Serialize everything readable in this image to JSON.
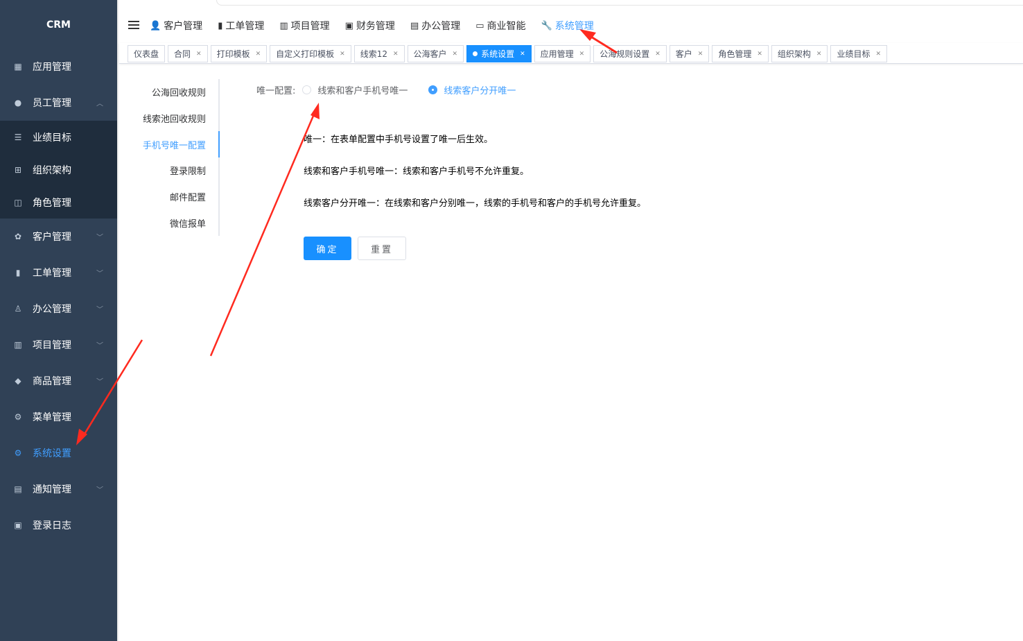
{
  "app": {
    "logo": "CRM"
  },
  "sidebar": {
    "items": [
      {
        "label": "应用管理",
        "icon": "grid-icon"
      },
      {
        "label": "员工管理",
        "icon": "user-icon",
        "expanded": true,
        "children": [
          {
            "label": "业绩目标",
            "icon": "list-icon"
          },
          {
            "label": "组织架构",
            "icon": "org-icon"
          },
          {
            "label": "角色管理",
            "icon": "role-icon"
          }
        ]
      },
      {
        "label": "客户管理",
        "icon": "customers-icon",
        "has_children": true
      },
      {
        "label": "工单管理",
        "icon": "clipboard-icon",
        "has_children": true
      },
      {
        "label": "办公管理",
        "icon": "stamp-icon",
        "has_children": true
      },
      {
        "label": "项目管理",
        "icon": "columns-icon",
        "has_children": true
      },
      {
        "label": "商品管理",
        "icon": "box-icon",
        "has_children": true
      },
      {
        "label": "菜单管理",
        "icon": "gear-icon"
      },
      {
        "label": "系统设置",
        "icon": "gear-icon",
        "active": true
      },
      {
        "label": "通知管理",
        "icon": "notice-icon",
        "has_children": true
      },
      {
        "label": "登录日志",
        "icon": "log-icon"
      }
    ]
  },
  "top_nav": {
    "items": [
      {
        "label": "客户管理",
        "icon": "user-icon"
      },
      {
        "label": "工单管理",
        "icon": "clipboard-icon"
      },
      {
        "label": "项目管理",
        "icon": "books-icon"
      },
      {
        "label": "财务管理",
        "icon": "finance-icon"
      },
      {
        "label": "办公管理",
        "icon": "office-icon"
      },
      {
        "label": "商业智能",
        "icon": "bi-icon"
      },
      {
        "label": "系统管理",
        "icon": "wrench-icon",
        "active": true
      }
    ]
  },
  "tags": [
    {
      "label": "仪表盘",
      "closable": false
    },
    {
      "label": "合同",
      "closable": true
    },
    {
      "label": "打印模板",
      "closable": true
    },
    {
      "label": "自定义打印模板",
      "closable": true
    },
    {
      "label": "线索12",
      "closable": true
    },
    {
      "label": "公海客户",
      "closable": true
    },
    {
      "label": "系统设置",
      "closable": true,
      "active": true
    },
    {
      "label": "应用管理",
      "closable": true
    },
    {
      "label": "公海规则设置",
      "closable": true
    },
    {
      "label": "客户",
      "closable": true
    },
    {
      "label": "角色管理",
      "closable": true
    },
    {
      "label": "组织架构",
      "closable": true
    },
    {
      "label": "业绩目标",
      "closable": true
    }
  ],
  "settings_menu": {
    "items": [
      {
        "label": "公海回收规则"
      },
      {
        "label": "线索池回收规则"
      },
      {
        "label": "手机号唯一配置",
        "active": true
      },
      {
        "label": "登录限制"
      },
      {
        "label": "邮件配置"
      },
      {
        "label": "微信报单"
      }
    ]
  },
  "form": {
    "label": "唯一配置:",
    "options": [
      {
        "label": "线索和客户手机号唯一",
        "checked": false
      },
      {
        "label": "线索客户分开唯一",
        "checked": true
      }
    ],
    "descriptions": [
      "唯一：在表单配置中手机号设置了唯一后生效。",
      "线索和客户手机号唯一：线索和客户手机号不允许重复。",
      "线索客户分开唯一：在线索和客户分别唯一，线索的手机号和客户的手机号允许重复。"
    ],
    "confirm_label": "确定",
    "reset_label": "重置"
  },
  "colors": {
    "sidebar_bg": "#304156",
    "accent": "#1890ff",
    "annotation_arrow": "#ff2a1f"
  }
}
